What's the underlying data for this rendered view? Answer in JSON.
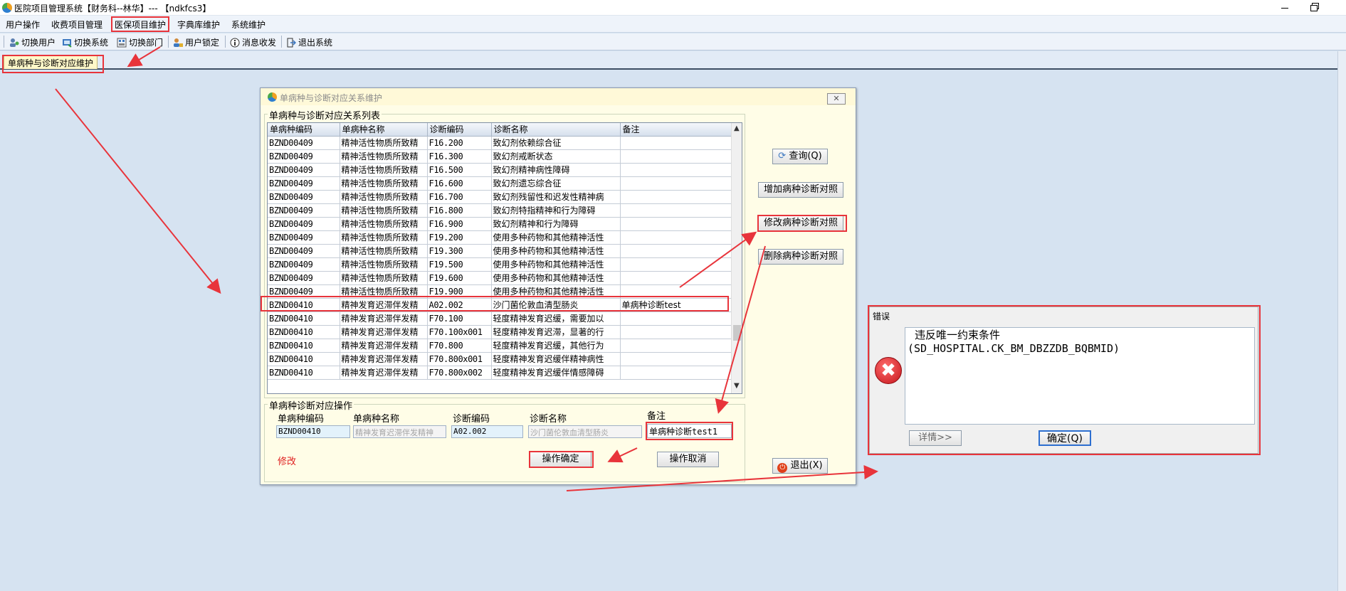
{
  "window": {
    "title": "医院项目管理系统【财务科--林华】--- 【ndkfcs3】"
  },
  "menubar": {
    "items": [
      "用户操作",
      "收费项目管理",
      "医保项目维护",
      "字典库维护",
      "系统维护"
    ]
  },
  "toolbar": {
    "items": [
      {
        "label": "切换用户",
        "icon": "switch-user-icon"
      },
      {
        "label": "切换系统",
        "icon": "switch-system-icon"
      },
      {
        "label": "切换部门",
        "icon": "switch-department-icon"
      },
      {
        "label": "用户锁定",
        "icon": "user-lock-icon"
      },
      {
        "label": "消息收发",
        "icon": "message-icon"
      },
      {
        "label": "退出系统",
        "icon": "exit-system-icon"
      }
    ]
  },
  "tabs": {
    "active": "单病种与诊断对应维护"
  },
  "dialog": {
    "title": "单病种与诊断对应关系维护",
    "close_label": "✕",
    "list_group_title": "单病种与诊断对应关系列表",
    "columns": [
      "单病种编码",
      "单病种名称",
      "诊断编码",
      "诊断名称",
      "备注"
    ],
    "rows": [
      [
        "BZND00409",
        "精神活性物质所致精",
        "F16.200",
        "致幻剂依赖综合征",
        ""
      ],
      [
        "BZND00409",
        "精神活性物质所致精",
        "F16.300",
        "致幻剂戒断状态",
        ""
      ],
      [
        "BZND00409",
        "精神活性物质所致精",
        "F16.500",
        "致幻剂精神病性障碍",
        ""
      ],
      [
        "BZND00409",
        "精神活性物质所致精",
        "F16.600",
        "致幻剂遗忘综合征",
        ""
      ],
      [
        "BZND00409",
        "精神活性物质所致精",
        "F16.700",
        "致幻剂残留性和迟发性精神病",
        ""
      ],
      [
        "BZND00409",
        "精神活性物质所致精",
        "F16.800",
        "致幻剂特指精神和行为障碍",
        ""
      ],
      [
        "BZND00409",
        "精神活性物质所致精",
        "F16.900",
        "致幻剂精神和行为障碍",
        ""
      ],
      [
        "BZND00409",
        "精神活性物质所致精",
        "F19.200",
        "使用多种药物和其他精神活性",
        ""
      ],
      [
        "BZND00409",
        "精神活性物质所致精",
        "F19.300",
        "使用多种药物和其他精神活性",
        ""
      ],
      [
        "BZND00409",
        "精神活性物质所致精",
        "F19.500",
        "使用多种药物和其他精神活性",
        ""
      ],
      [
        "BZND00409",
        "精神活性物质所致精",
        "F19.600",
        "使用多种药物和其他精神活性",
        ""
      ],
      [
        "BZND00409",
        "精神活性物质所致精",
        "F19.900",
        "使用多种药物和其他精神活性",
        ""
      ],
      [
        "BZND00410",
        "精神发育迟滞伴发精",
        "A02.002",
        "沙门菌伦敦血清型肠炎",
        "单病种诊断test"
      ],
      [
        "BZND00410",
        "精神发育迟滞伴发精",
        "F70.100",
        "轻度精神发育迟缓，需要加以",
        ""
      ],
      [
        "BZND00410",
        "精神发育迟滞伴发精",
        "F70.100x001",
        "轻度精神发育迟滞，显著的行",
        ""
      ],
      [
        "BZND00410",
        "精神发育迟滞伴发精",
        "F70.800",
        "轻度精神发育迟缓，其他行为",
        ""
      ],
      [
        "BZND00410",
        "精神发育迟滞伴发精",
        "F70.800x001",
        "轻度精神发育迟缓伴精神病性",
        ""
      ],
      [
        "BZND00410",
        "精神发育迟滞伴发精",
        "F70.800x002",
        "轻度精神发育迟缓伴情感障碍",
        ""
      ]
    ],
    "op_group_title": "单病种诊断对应操作",
    "form": {
      "disease_code_label": "单病种编码",
      "disease_code_value": "BZND00410",
      "disease_name_label": "单病种名称",
      "disease_name_value": "精神发育迟滞伴发精神",
      "diag_code_label": "诊断编码",
      "diag_code_value": "A02.002",
      "diag_name_label": "诊断名称",
      "diag_name_value": "沙门菌伦敦血清型肠炎",
      "remark_label": "备注",
      "remark_value": "单病种诊断test1"
    },
    "mode_text": "修改",
    "buttons": {
      "query": "查询(Q)",
      "add": "增加病种诊断对照",
      "modify": "修改病种诊断对照",
      "delete": "删除病种诊断对照",
      "confirm": "操作确定",
      "cancel": "操作取消",
      "exit": "退出(X)"
    }
  },
  "error_dialog": {
    "title": "错误",
    "message_line1": "违反唯一约束条件",
    "message_line2": "(SD_HOSPITAL.CK_BM_DBZZDB_BQBMID)",
    "details_button": "详情>>",
    "ok_button": "确定(Q)",
    "icon": "error-icon"
  },
  "colors": {
    "highlight_border": "#e8343b",
    "arrow": "#e8343b",
    "desktop_bg": "#d6e3f1",
    "dialog_bg": "#fffde7"
  }
}
